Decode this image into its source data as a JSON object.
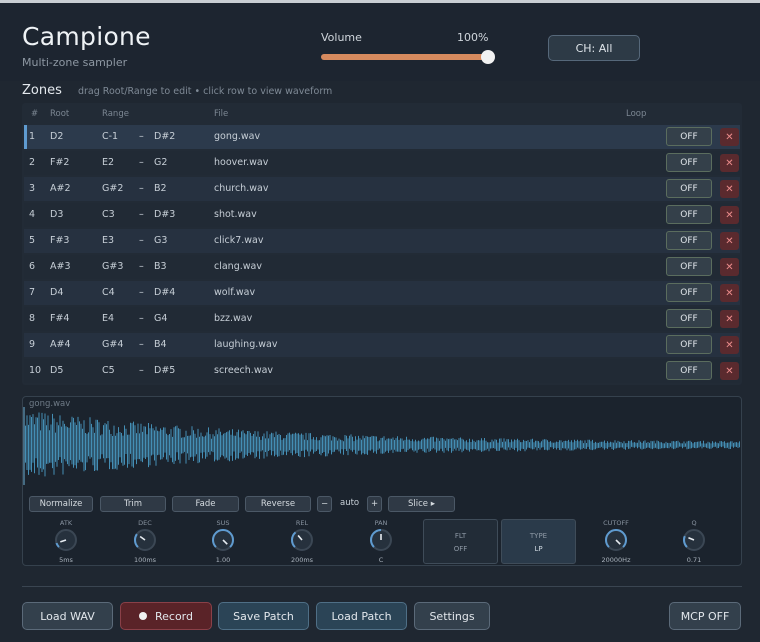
{
  "header": {
    "title": "Campione",
    "subtitle": "Multi-zone sampler",
    "volume_label": "Volume",
    "volume_value": "100%",
    "volume_level": 1.0,
    "channel_button": "CH: All"
  },
  "zones": {
    "title": "Zones",
    "hint": "drag Root/Range to edit  •  click row to view waveform",
    "columns": [
      "#",
      "Root",
      "Range",
      "File",
      "Loop"
    ],
    "range_sep": "–",
    "delete_glyph": "✕",
    "selected_index": 0,
    "rows": [
      {
        "num": "1",
        "root": "D2",
        "lo": "C-1",
        "hi": "D#2",
        "file": "gong.wav",
        "loop": "OFF"
      },
      {
        "num": "2",
        "root": "F#2",
        "lo": "E2",
        "hi": "G2",
        "file": "hoover.wav",
        "loop": "OFF"
      },
      {
        "num": "3",
        "root": "A#2",
        "lo": "G#2",
        "hi": "B2",
        "file": "church.wav",
        "loop": "OFF"
      },
      {
        "num": "4",
        "root": "D3",
        "lo": "C3",
        "hi": "D#3",
        "file": "shot.wav",
        "loop": "OFF"
      },
      {
        "num": "5",
        "root": "F#3",
        "lo": "E3",
        "hi": "G3",
        "file": "click7.wav",
        "loop": "OFF"
      },
      {
        "num": "6",
        "root": "A#3",
        "lo": "G#3",
        "hi": "B3",
        "file": "clang.wav",
        "loop": "OFF"
      },
      {
        "num": "7",
        "root": "D4",
        "lo": "C4",
        "hi": "D#4",
        "file": "wolf.wav",
        "loop": "OFF"
      },
      {
        "num": "8",
        "root": "F#4",
        "lo": "E4",
        "hi": "G4",
        "file": "bzz.wav",
        "loop": "OFF"
      },
      {
        "num": "9",
        "root": "A#4",
        "lo": "G#4",
        "hi": "B4",
        "file": "laughing.wav",
        "loop": "OFF"
      },
      {
        "num": "10",
        "root": "D5",
        "lo": "C5",
        "hi": "D#5",
        "file": "screech.wav",
        "loop": "OFF"
      }
    ]
  },
  "waveform": {
    "file": "gong.wav",
    "tools": {
      "normalize": "Normalize",
      "trim": "Trim",
      "fade": "Fade",
      "reverse": "Reverse",
      "minus": "−",
      "auto": "auto",
      "plus": "+",
      "slice": "Slice ▸"
    }
  },
  "envelope": {
    "knobs": [
      {
        "label": "ATK",
        "value": "5ms",
        "level": 0.1
      },
      {
        "label": "DEC",
        "value": "100ms",
        "level": 0.3
      },
      {
        "label": "SUS",
        "value": "1.00",
        "level": 1.0
      },
      {
        "label": "REL",
        "value": "200ms",
        "level": 0.35
      },
      {
        "label": "PAN",
        "value": "C",
        "level": 0.5
      }
    ],
    "filter_toggle": {
      "label": "FLT",
      "value": "OFF"
    },
    "type_toggle": {
      "label": "TYPE",
      "value": "LP"
    },
    "cutoff": {
      "label": "CUTOFF",
      "value": "20000Hz",
      "level": 1.0
    },
    "q": {
      "label": "Q",
      "value": "0.71",
      "level": 0.25
    }
  },
  "footer": {
    "load_wav": "Load WAV",
    "record": "Record",
    "save_patch": "Save Patch",
    "load_patch": "Load Patch",
    "settings": "Settings",
    "mcp": "MCP OFF"
  },
  "colors": {
    "accent": "#d68a5e",
    "selection": "#5f9bd0",
    "wave": "#4a9bc4",
    "danger": "#5a2a2e"
  }
}
